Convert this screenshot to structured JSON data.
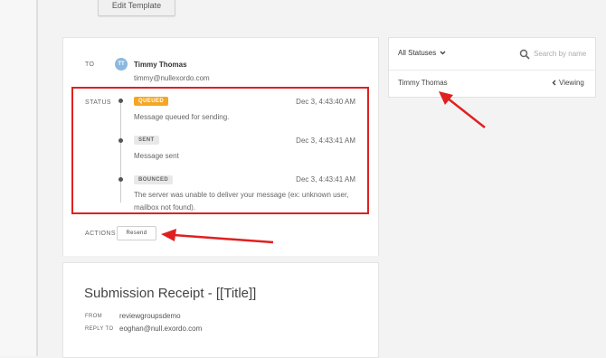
{
  "toolbar": {
    "edit_template_label": "Edit Template"
  },
  "message": {
    "to_label": "To",
    "recipient": {
      "initials": "TT",
      "name": "Timmy Thomas",
      "email": "timmy@nullexordo.com"
    },
    "status_label": "Status",
    "events": [
      {
        "badge": "Queued",
        "timestamp": "Dec 3, 4:43:40 AM",
        "message": "Message queued for sending."
      },
      {
        "badge": "Sent",
        "timestamp": "Dec 3, 4:43:41 AM",
        "message": "Message sent"
      },
      {
        "badge": "Bounced",
        "timestamp": "Dec 3, 4:43:41 AM",
        "message_line1": "The server was unable to deliver your message (ex: unknown user,",
        "message_line2": "mailbox not found)."
      }
    ],
    "actions_label": "Actions",
    "resend_label": "Resend"
  },
  "receipt": {
    "title": "Submission Receipt - [[Title]]",
    "from_label": "From",
    "from_value": "reviewgroupsdemo",
    "reply_to_label": "Reply To",
    "reply_to_value": "eoghan@null.exordo.com"
  },
  "side_panel": {
    "status_filter": "All Statuses",
    "search_placeholder": "Search by name",
    "rows": [
      {
        "name": "Timmy Thomas",
        "state": "Viewing"
      }
    ]
  },
  "colors": {
    "highlight_red": "#e02020",
    "queued_orange": "#f5a623",
    "avatar_blue": "#8ab8e0"
  },
  "icons": {
    "dropdown": "chevron-down-icon",
    "search": "search-icon",
    "viewing": "chevron-left-icon"
  }
}
